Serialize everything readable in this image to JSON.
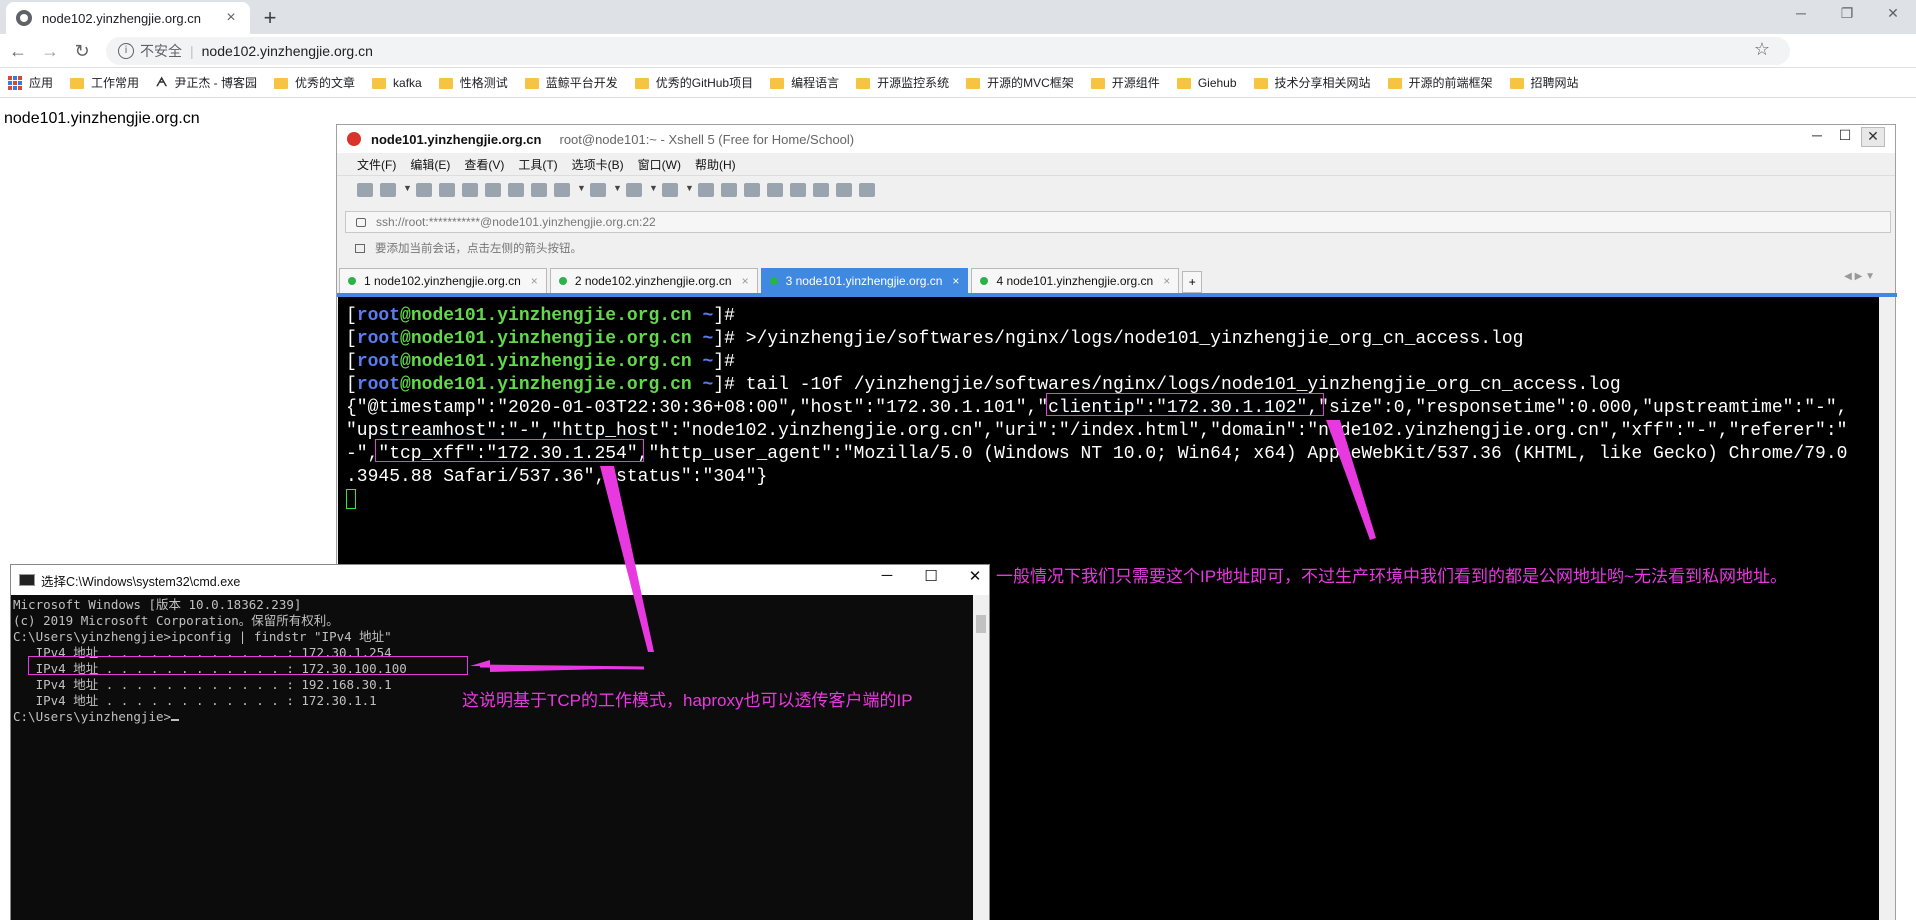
{
  "browser": {
    "tab_title": "node102.yinzhengjie.org.cn",
    "tab_close": "×",
    "new_tab": "+",
    "security_label": "不安全",
    "url": "node102.yinzhengjie.org.cn",
    "bookmarks": [
      "应用",
      "工作常用",
      "尹正杰 - 博客园",
      "优秀的文章",
      "kafka",
      "性格测试",
      "蓝鲸平台开发",
      "优秀的GitHub项目",
      "编程语言",
      "开源监控系统",
      "开源的MVC框架",
      "开源组件",
      "Giehub",
      "技术分享相关网站",
      "开源的前端框架",
      "招聘网站"
    ]
  },
  "page": {
    "text": "node101.yinzhengjie.org.cn"
  },
  "xshell": {
    "title_host": "node101.yinzhengjie.org.cn",
    "title_sub": "root@node101:~ - Xshell 5 (Free for Home/School)",
    "menu": [
      "文件(F)",
      "编辑(E)",
      "查看(V)",
      "工具(T)",
      "选项卡(B)",
      "窗口(W)",
      "帮助(H)"
    ],
    "address": "ssh://root:***********@node101.yinzhengjie.org.cn:22",
    "hint": "要添加当前会话，点击左侧的箭头按钮。",
    "tabs": [
      {
        "label": "1 node102.yinzhengjie.org.cn",
        "active": false
      },
      {
        "label": "2 node102.yinzhengjie.org.cn",
        "active": false
      },
      {
        "label": "3 node101.yinzhengjie.org.cn",
        "active": true
      },
      {
        "label": "4 node101.yinzhengjie.org.cn",
        "active": false
      }
    ],
    "prompt": {
      "open": "[",
      "user": "root",
      "at": "@",
      "host": "node101.yinzhengjie.org.cn",
      "tilde": " ~",
      "close": "]#"
    },
    "commands": [
      "",
      " >/yinzhengjie/softwares/nginx/logs/node101_yinzhengjie_org_cn_access.log",
      "",
      " tail -10f /yinzhengjie/softwares/nginx/logs/node101_yinzhengjie_org_cn_access.log"
    ],
    "log_lines": [
      "{\"@timestamp\":\"2020-01-03T22:30:36+08:00\",\"host\":\"172.30.1.101\",\"clientip\":\"172.30.1.102\",\"size\":0,\"responsetime\":0.000,\"upstreamtime\":\"-\",",
      "\"upstreamhost\":\"-\",\"http_host\":\"node102.yinzhengjie.org.cn\",\"uri\":\"/index.html\",\"domain\":\"node102.yinzhengjie.org.cn\",\"xff\":\"-\",\"referer\":\"",
      "-\",\"tcp_xff\":\"172.30.1.254\",\"http_user_agent\":\"Mozilla/5.0 (Windows NT 10.0; Win64; x64) AppleWebKit/537.36 (KHTML, like Gecko) Chrome/79.0",
      ".3945.88 Safari/537.36\",\"status\":\"304\"}"
    ]
  },
  "cmd": {
    "title": "选择C:\\Windows\\system32\\cmd.exe",
    "lines": [
      "Microsoft Windows [版本 10.0.18362.239]",
      "(c) 2019 Microsoft Corporation。保留所有权利。",
      "",
      "C:\\Users\\yinzhengjie>ipconfig | findstr \"IPv4 地址\"",
      "   IPv4 地址 . . . . . . . . . . . . : 172.30.1.254",
      "   IPv4 地址 . . . . . . . . . . . . : 172.30.100.100",
      "   IPv4 地址 . . . . . . . . . . . . : 192.168.30.1",
      "   IPv4 地址 . . . . . . . . . . . . : 172.30.1.1",
      "",
      "C:\\Users\\yinzhengjie>"
    ]
  },
  "annotations": {
    "note_right": "一般情况下我们只需要这个IP地址即可，不过生产环境中我们看到的都是公网地址哟~无法看到私网地址。",
    "note_bottom": "这说明基于TCP的工作模式，haproxy也可以透传客户端的IP",
    "color": "#e838e0"
  }
}
